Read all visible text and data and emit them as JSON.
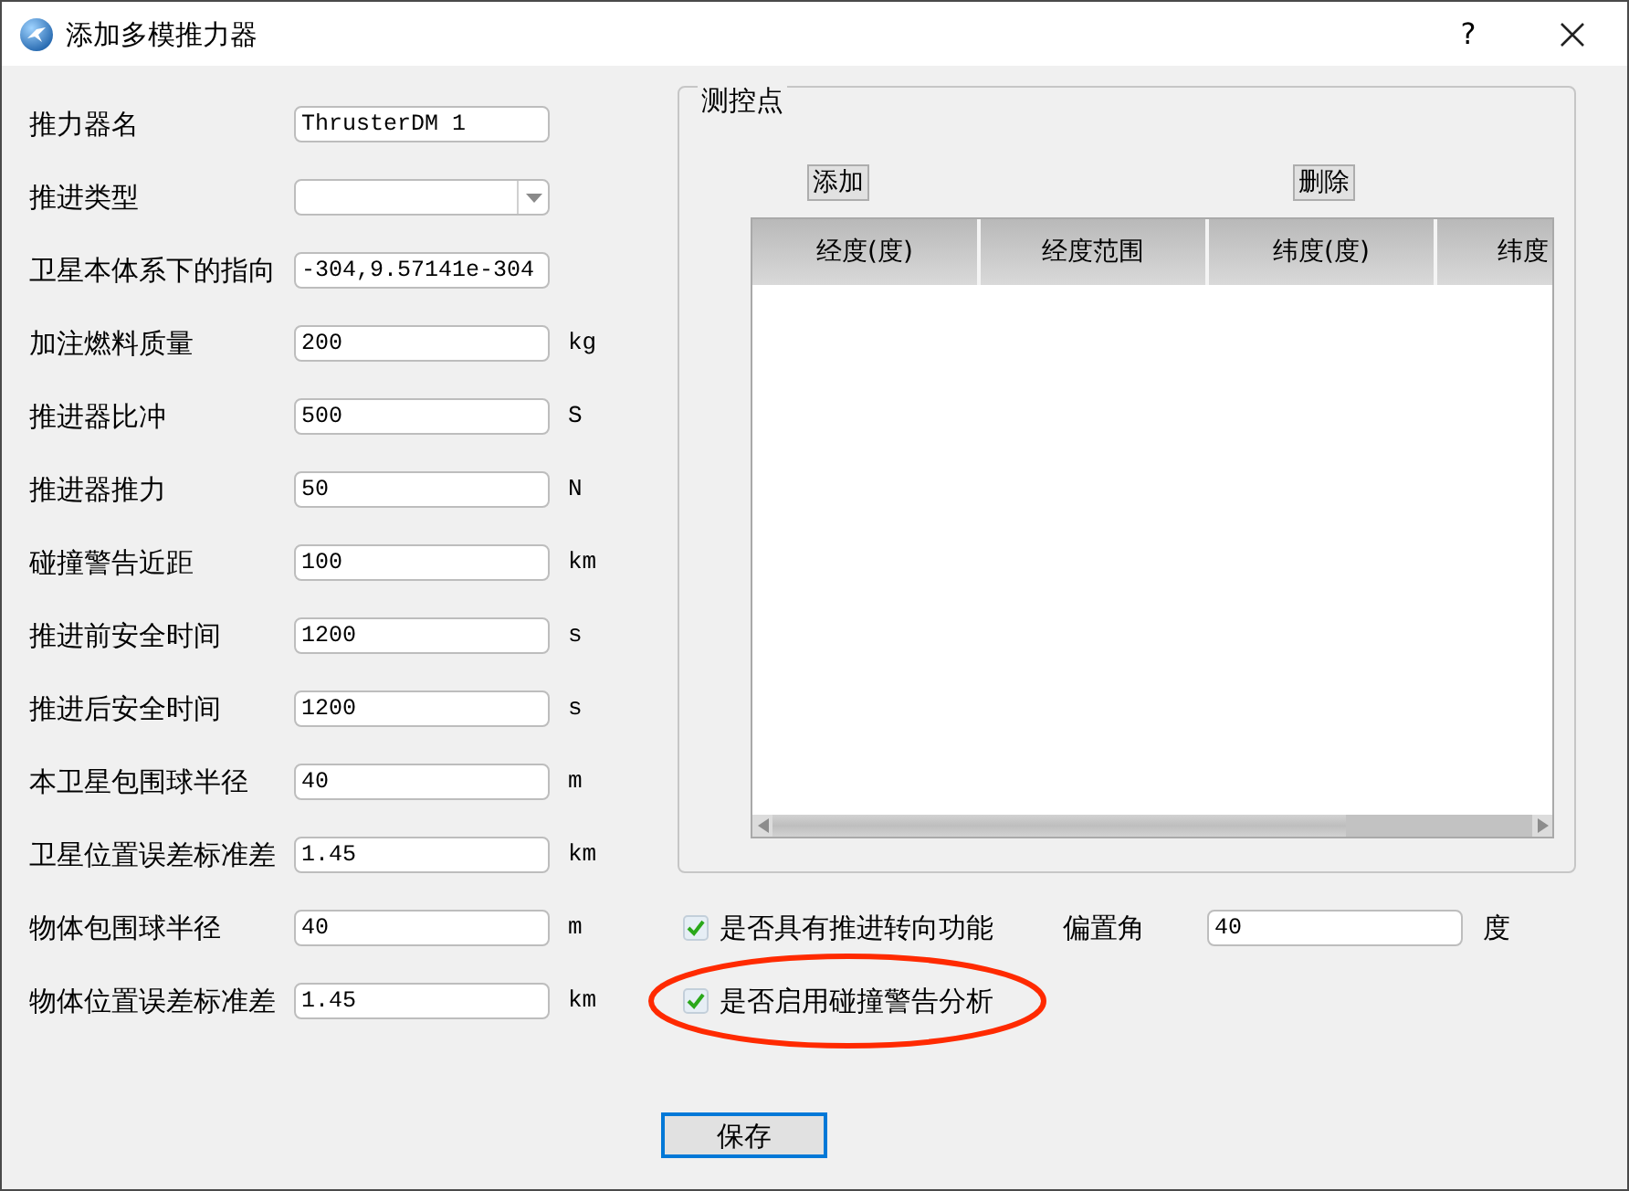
{
  "window": {
    "title": "添加多模推力器",
    "help_button": "?"
  },
  "form": {
    "fields": [
      {
        "kind": "text",
        "label": "推力器名",
        "value": "ThrusterDM 1"
      },
      {
        "kind": "combo",
        "label": "推进类型"
      },
      {
        "kind": "text",
        "label": "卫星本体系下的指向",
        "value": "-304,9.57141e-304"
      },
      {
        "kind": "text",
        "label": "加注燃料质量",
        "value": "200",
        "unit": "kg"
      },
      {
        "kind": "text",
        "label": "推进器比冲",
        "value": "500",
        "unit": "S"
      },
      {
        "kind": "text",
        "label": "推进器推力",
        "value": "50",
        "unit": "N"
      },
      {
        "kind": "text",
        "label": "碰撞警告近距",
        "value": "100",
        "unit": "km"
      },
      {
        "kind": "text",
        "label": "推进前安全时间",
        "value": "1200",
        "unit": "s"
      },
      {
        "kind": "text",
        "label": "推进后安全时间",
        "value": "1200",
        "unit": "s"
      },
      {
        "kind": "text",
        "label": "本卫星包围球半径",
        "value": "40",
        "unit": "m"
      },
      {
        "kind": "text",
        "label": "卫星位置误差标准差",
        "value": "1.45",
        "unit": "km"
      },
      {
        "kind": "text",
        "label": "物体包围球半径",
        "value": "40",
        "unit": "m"
      },
      {
        "kind": "text",
        "label": "物体位置误差标准差",
        "value": "1.45",
        "unit": "km"
      }
    ]
  },
  "ground_stations": {
    "title": "测控点",
    "buttons": [
      "添加",
      "删除"
    ],
    "table": {
      "columns": [
        "经度(度)",
        "经度范围",
        "纬度(度)",
        "纬度"
      ]
    }
  },
  "options": [
    {
      "label": "是否具有推进转向功能",
      "checked": true,
      "highlighted": false,
      "angle": {
        "label": "偏置角",
        "value": "40",
        "unit": "度"
      }
    },
    {
      "label": "是否启用碰撞警告分析",
      "checked": true,
      "highlighted": true
    }
  ],
  "save_button": "保存"
}
